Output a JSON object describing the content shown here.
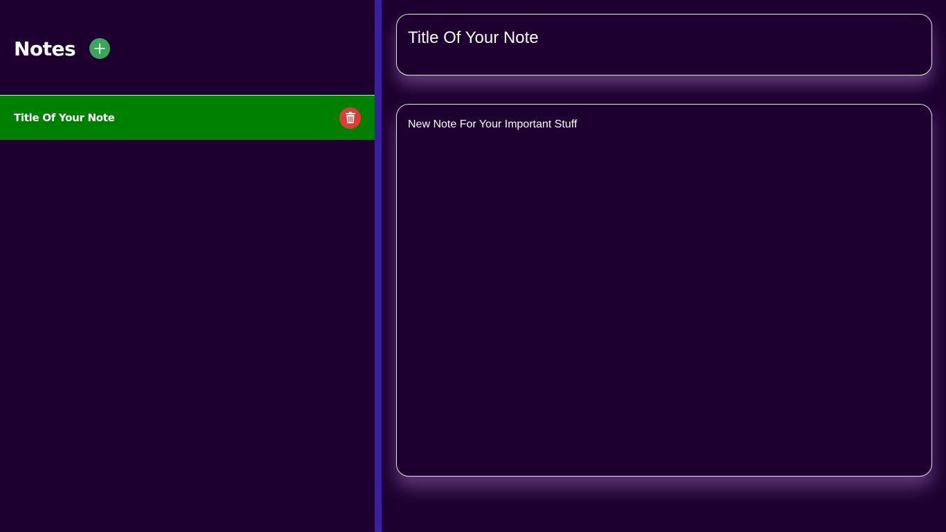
{
  "sidebar": {
    "title": "Notes",
    "add_icon": "plus-icon",
    "notes": [
      {
        "title": "Title Of Your Note",
        "delete_icon": "trash-icon",
        "selected": true
      }
    ]
  },
  "editor": {
    "title_value": "Title Of Your Note",
    "body_value": "New Note For Your Important Stuff"
  },
  "colors": {
    "background": "#1e0030",
    "divider": "#3b1da6",
    "selected_note": "#008000",
    "add_button": "#3ba55c",
    "delete_button": "#e53935"
  }
}
